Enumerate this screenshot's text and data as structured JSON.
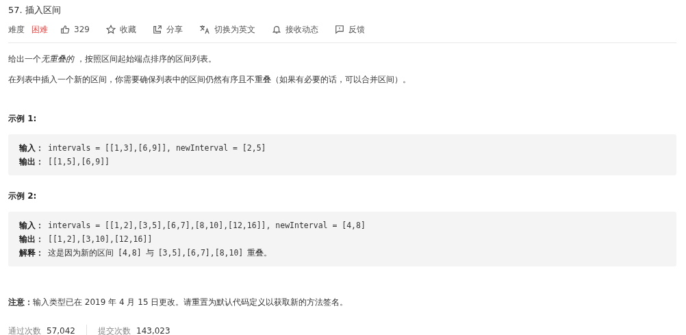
{
  "title": "57. 插入区间",
  "meta": {
    "difficulty_label": "难度",
    "difficulty": "困难"
  },
  "actions": [
    {
      "kind": "like",
      "label": "329"
    },
    {
      "kind": "star",
      "label": "收藏"
    },
    {
      "kind": "share",
      "label": "分享"
    },
    {
      "kind": "translate",
      "label": "切换为英文"
    },
    {
      "kind": "bell",
      "label": "接收动态"
    },
    {
      "kind": "feedback",
      "label": "反馈"
    }
  ],
  "description": [
    [
      {
        "kind": "plain",
        "text": "给出一个"
      },
      {
        "kind": "italic",
        "text": "无重叠的"
      },
      {
        "kind": "plain",
        "text": " ，按照区间起始端点排序的区间列表。"
      }
    ],
    [
      {
        "kind": "plain",
        "text": "在列表中插入一个新的区间，你需要确保列表中的区间仍然有序且不重叠（如果有必要的话，可以合并区间）。"
      }
    ]
  ],
  "examples": [
    {
      "heading": "示例 1:",
      "lines": [
        {
          "label": "输入：",
          "segments": [
            {
              "kind": "code",
              "text": "intervals = [[1,3],[6,9]], newInterval = [2,5]"
            }
          ]
        },
        {
          "label": "输出：",
          "segments": [
            {
              "kind": "code",
              "text": "[[1,5],[6,9]]"
            }
          ]
        }
      ]
    },
    {
      "heading": "示例 2:",
      "lines": [
        {
          "label": "输入：",
          "segments": [
            {
              "kind": "code",
              "text": "intervals = [[1,2],[3,5],[6,7],[8,10],[12,16]], newInterval = [4,8]"
            }
          ]
        },
        {
          "label": "输出：",
          "segments": [
            {
              "kind": "code",
              "text": "[[1,2],[3,10],[12,16]]"
            }
          ]
        },
        {
          "label": "解释：",
          "segments": [
            {
              "kind": "text",
              "text": "这是因为新的区间"
            },
            {
              "kind": "code",
              "text": "[4,8]"
            },
            {
              "kind": "text",
              "text": "与"
            },
            {
              "kind": "code",
              "text": "[3,5],[6,7],[8,10]"
            },
            {
              "kind": "text",
              "text": "重叠。"
            }
          ]
        }
      ]
    }
  ],
  "note": "**注意：**输入类型已在 2019 年 4 月 15 日更改。请重置为默认代码定义以获取新的方法签名。",
  "stats": [
    {
      "label": "通过次数",
      "value": "57,042"
    },
    {
      "label": "提交次数",
      "value": "143,023"
    }
  ]
}
